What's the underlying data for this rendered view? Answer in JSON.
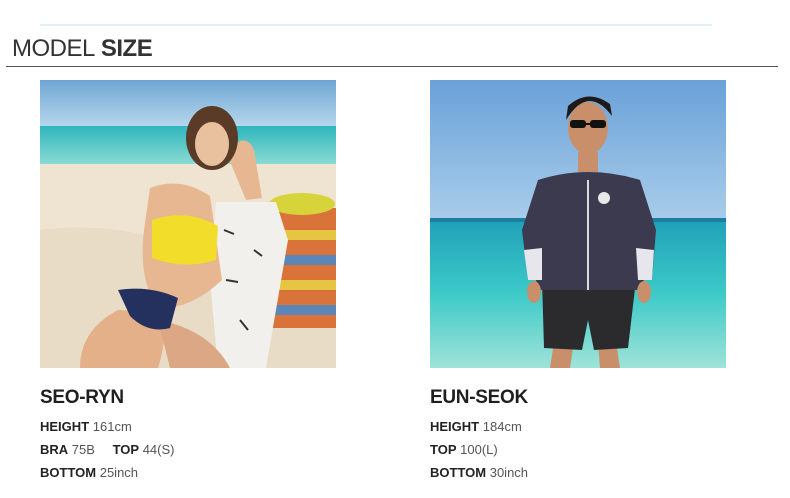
{
  "header": {
    "title_light": "MODEL",
    "title_bold": "SIZE"
  },
  "models": [
    {
      "name": "SEO-RYN",
      "height_label": "HEIGHT",
      "height_value": "161cm",
      "bra_label": "BRA",
      "bra_value": "75B",
      "top_label": "TOP",
      "top_value": "44(S)",
      "bottom_label": "BOTTOM",
      "bottom_value": "25inch"
    },
    {
      "name": "EUN-SEOK",
      "height_label": "HEIGHT",
      "height_value": "184cm",
      "top_label": "TOP",
      "top_value": "100(L)",
      "bottom_label": "BOTTOM",
      "bottom_value": "30inch"
    }
  ],
  "colors": {
    "sky": "#7fb2dc",
    "sea": "#3cc7c8",
    "sand": "#efe6d6",
    "bikini": "#f2dd2a",
    "rashguard": "#3b3a4f"
  }
}
